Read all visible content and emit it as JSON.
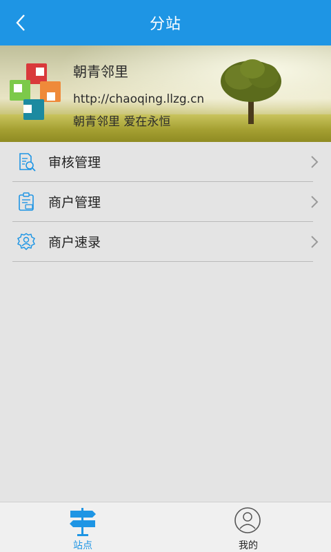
{
  "header": {
    "title": "分站",
    "back_icon": "chevron-left-icon"
  },
  "profile": {
    "name": "朝青邻里",
    "url": "http://chaoqing.llzg.cn",
    "slogan": "朝青邻里 爱在永恒"
  },
  "menu": [
    {
      "label": "审核管理",
      "icon": "audit-document-icon"
    },
    {
      "label": "商户管理",
      "icon": "merchant-clipboard-icon"
    },
    {
      "label": "商户速录",
      "icon": "gear-user-icon"
    }
  ],
  "tabbar": {
    "items": [
      {
        "label": "站点",
        "icon": "signpost-icon",
        "active": true
      },
      {
        "label": "我的",
        "icon": "user-avatar-icon",
        "active": false
      }
    ]
  },
  "colors": {
    "accent": "#1e95e4",
    "background": "#e4e4e4"
  }
}
